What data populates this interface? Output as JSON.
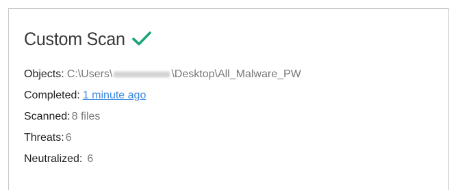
{
  "scan": {
    "title": "Custom Scan",
    "status_icon": "checkmark-icon",
    "status_color": "#1aa37a",
    "objects_label": "Objects:",
    "objects_value_prefix": "C:\\Users\\",
    "objects_value_suffix": "\\Desktop\\All_Malware_PW",
    "completed_label": "Completed:",
    "completed_value": "1 minute ago",
    "scanned_label": "Scanned:",
    "scanned_value": "8 files",
    "threats_label": "Threats:",
    "threats_value": "6",
    "neutralized_label": "Neutralized:",
    "neutralized_value": "6"
  }
}
